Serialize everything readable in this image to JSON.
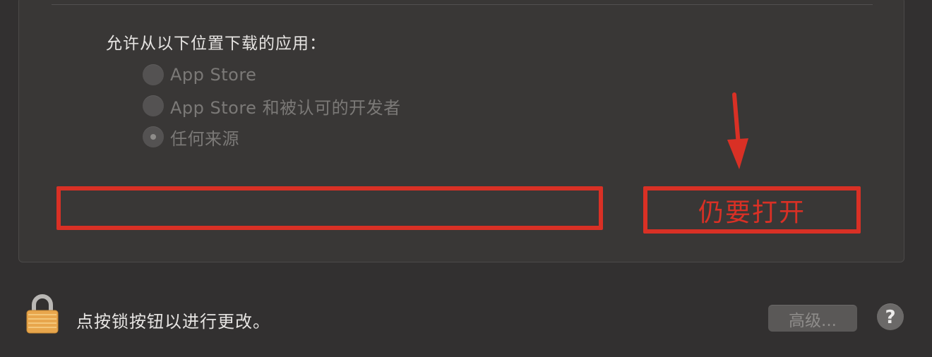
{
  "security": {
    "allow_label": "允许从以下位置下载的应用：",
    "options": [
      {
        "label": "App Store",
        "checked": false
      },
      {
        "label": "App Store 和被认可的开发者",
        "checked": false
      },
      {
        "label": "任何来源",
        "checked": true
      }
    ],
    "open_anyway_label": "仍要打开"
  },
  "footer": {
    "lock_text": "点按锁按钮以进行更改。",
    "advanced_label": "高级...",
    "help_label": "?"
  },
  "colors": {
    "annotation_red": "#d93025",
    "background": "#323030",
    "panel": "#393736"
  },
  "icons": {
    "lock": "lock-icon",
    "arrow": "arrow-down-icon"
  }
}
